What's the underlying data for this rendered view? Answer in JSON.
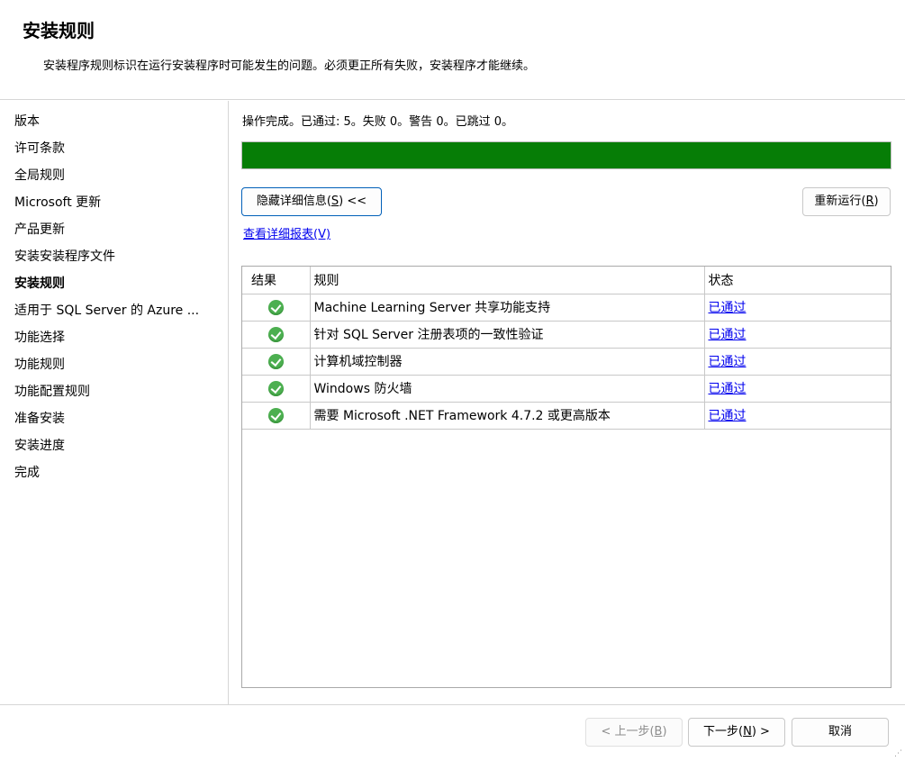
{
  "header": {
    "title": "安装规则",
    "description": "安装程序规则标识在运行安装程序时可能发生的问题。必须更正所有失败，安装程序才能继续。"
  },
  "sidebar": {
    "steps": [
      "版本",
      "许可条款",
      "全局规则",
      "Microsoft 更新",
      "产品更新",
      "安装安装程序文件",
      "安装规则",
      "适用于 SQL Server 的 Azure ...",
      "功能选择",
      "功能规则",
      "功能配置规则",
      "准备安装",
      "安装进度",
      "完成"
    ],
    "active_step": "安装规则"
  },
  "main": {
    "status_text": "操作完成。已通过: 5。失败 0。警告 0。已跳过 0。",
    "progress_percent": 100,
    "progress_color": "#067d06",
    "hide_details_button": {
      "prefix": "隐藏详细信息(",
      "accel": "S",
      "suffix": ") <<"
    },
    "rerun_button": {
      "prefix": "重新运行(",
      "accel": "R",
      "suffix": ")"
    },
    "view_report_link": "查看详细报表(V)",
    "table": {
      "columns": [
        "结果",
        "规则",
        "状态"
      ],
      "rows": [
        {
          "result_icon": "check-circle-icon",
          "rule": "Machine Learning Server 共享功能支持",
          "status": "已通过"
        },
        {
          "result_icon": "check-circle-icon",
          "rule": "针对 SQL Server 注册表项的一致性验证",
          "status": "已通过"
        },
        {
          "result_icon": "check-circle-icon",
          "rule": "计算机域控制器",
          "status": "已通过"
        },
        {
          "result_icon": "check-circle-icon",
          "rule": "Windows 防火墙",
          "status": "已通过"
        },
        {
          "result_icon": "check-circle-icon",
          "rule": "需要 Microsoft .NET Framework 4.7.2 或更高版本",
          "status": "已通过"
        }
      ]
    }
  },
  "footer": {
    "back_button": {
      "prefix": "< 上一步(",
      "accel": "B",
      "suffix": ")"
    },
    "next_button": {
      "prefix": "下一步(",
      "accel": "N",
      "suffix": ") >"
    },
    "cancel_button": "取消"
  }
}
